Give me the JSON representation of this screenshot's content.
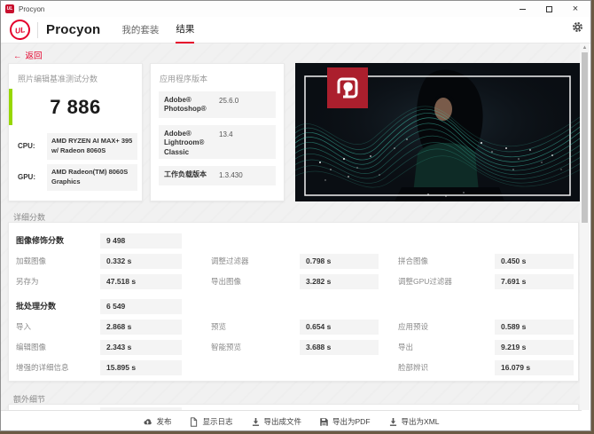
{
  "window": {
    "title": "Procyon",
    "icon_text": "UL"
  },
  "header": {
    "logo_text": "UL",
    "brand": "Procyon",
    "tabs": [
      {
        "label": "我的套装"
      },
      {
        "label": "结果"
      }
    ]
  },
  "back_label": "返回",
  "back_arrow": "←",
  "summary": {
    "title": "照片编辑基准测试分数",
    "score": "7 886",
    "specs": [
      {
        "label": "CPU:",
        "value": "AMD RYZEN AI MAX+ 395 w/ Radeon 8060S"
      },
      {
        "label": "GPU:",
        "value": "AMD Radeon(TM) 8060S Graphics"
      }
    ]
  },
  "versions": {
    "title": "应用程序版本",
    "rows": [
      {
        "label": "Adobe® Photoshop®",
        "value": "25.6.0"
      },
      {
        "label": "Adobe® Lightroom® Classic",
        "value": "13.4"
      },
      {
        "label": "工作负载版本",
        "value": "1.3.430"
      }
    ]
  },
  "detailed": {
    "title": "详细分数",
    "sections": [
      {
        "score_label": "图像修饰分数",
        "score": "9 498",
        "rows": [
          [
            {
              "label": "加载图像",
              "value": "0.332 s"
            },
            {
              "label": "调整过滤器",
              "value": "0.798 s"
            },
            {
              "label": "拼合图像",
              "value": "0.450 s"
            }
          ],
          [
            {
              "label": "另存为",
              "value": "47.518 s"
            },
            {
              "label": "导出图像",
              "value": "3.282 s"
            },
            {
              "label": "调整GPU过滤器",
              "value": "7.691 s"
            }
          ]
        ]
      },
      {
        "score_label": "批处理分数",
        "score": "6 549",
        "rows": [
          [
            {
              "label": "导入",
              "value": "2.868 s"
            },
            {
              "label": "预览",
              "value": "0.654 s"
            },
            {
              "label": "应用预设",
              "value": "0.589 s"
            }
          ],
          [
            {
              "label": "编辑图像",
              "value": "2.343 s"
            },
            {
              "label": "智能预览",
              "value": "3.688 s"
            },
            {
              "label": "导出",
              "value": "9.219 s"
            }
          ],
          [
            {
              "label": "增强的详细信息",
              "value": "15.895 s"
            },
            null,
            {
              "label": "脸部辨识",
              "value": "16.079 s"
            }
          ]
        ]
      }
    ]
  },
  "extra": {
    "title": "额外细节"
  },
  "footer": {
    "buttons": [
      {
        "icon": "cloud-upload-icon",
        "label": "发布"
      },
      {
        "icon": "document-icon",
        "label": "显示日志"
      },
      {
        "icon": "download-icon",
        "label": "导出成文件"
      },
      {
        "icon": "save-icon",
        "label": "导出为PDF"
      },
      {
        "icon": "download-icon",
        "label": "导出为XML"
      }
    ]
  },
  "colors": {
    "accent_red": "#e4002b",
    "accent_green": "#97d700",
    "hero_logo_red": "#ab1f2d",
    "wave_teal": "#46dcc0"
  }
}
